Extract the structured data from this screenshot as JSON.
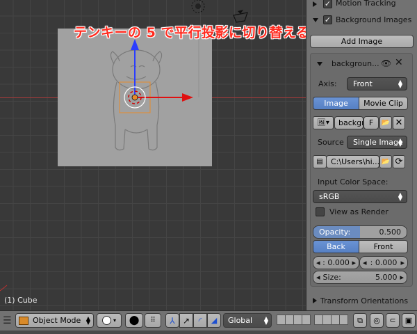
{
  "viewport": {
    "hud_title": "テンキーの 5 で平行投影に切り替える",
    "object_info": "(1) Cube"
  },
  "panel": {
    "motion_tracking": {
      "label": "Motion Tracking",
      "checked": true
    },
    "background_images": {
      "label": "Background Images",
      "checked": true
    },
    "add_image_label": "Add Image",
    "image_slot": {
      "name": "backgroun...",
      "axis_label": "Axis:",
      "axis_value": "Front",
      "source_tabs": [
        "Image",
        "Movie Clip"
      ],
      "active_source_tab": "Image",
      "image_name": "backgr",
      "image_flag": "F",
      "source_label": "Source",
      "source_value": "Single Image",
      "filepath": "C:\\Users\\hi...",
      "input_color_space_label": "Input Color Space:",
      "color_space_value": "sRGB",
      "view_as_render_label": "View as Render",
      "view_as_render_checked": false,
      "opacity_label": "Opacity:",
      "opacity_value": "0.500",
      "order_tabs": [
        "Back",
        "Front"
      ],
      "active_order_tab": "Back",
      "offset_x": ": 0.000",
      "offset_y": ": 0.000",
      "size_label": "Size:",
      "size_value": "5.000"
    },
    "transform_orientations_label": "Transform Orientations"
  },
  "bottom_bar": {
    "menu_glyph": "☰",
    "mode_label": "Object Mode",
    "orientation_label": "Global"
  },
  "colors": {
    "accent_blue": "#5680c4",
    "hud_red": "#ff2b1f",
    "x_axis": "#a33a3a",
    "panel_bg": "#727272"
  }
}
